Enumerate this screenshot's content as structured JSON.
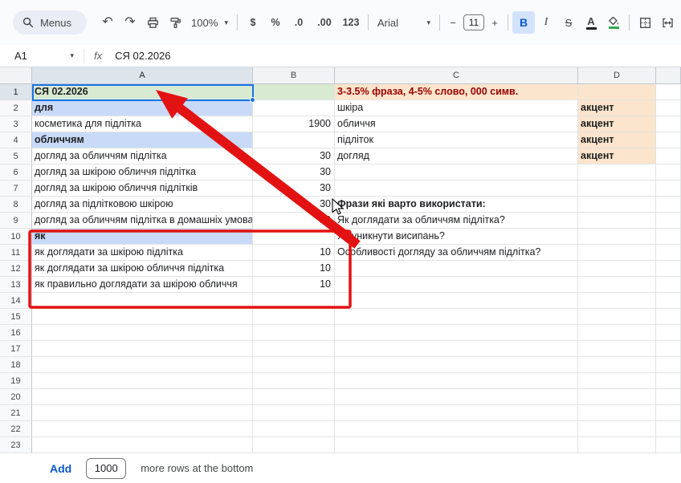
{
  "toolbar": {
    "menus_label": "Menus",
    "zoom": "100%",
    "currency": "$",
    "percent": "%",
    "decrease_decimal": ".0",
    "increase_decimal": ".00",
    "number_format": "123",
    "font_family": "Arial",
    "font_size": "11",
    "decrease_font": "−",
    "increase_font": "+",
    "bold": "B",
    "italic": "I",
    "strikethrough": "S",
    "text_color": "A"
  },
  "icons": {
    "dropdown": "▾",
    "undo": "↶",
    "redo": "↷"
  },
  "formula_bar": {
    "cell_reference": "A1",
    "fx_label": "fx",
    "formula_value": "СЯ 02.2026"
  },
  "sheet": {
    "columns": [
      "A",
      "B",
      "C",
      "D"
    ],
    "row_count": 23,
    "selected_cell": "A1",
    "selected_col": "A",
    "selected_row": 1,
    "cells": [
      {
        "c": "A",
        "r": 1,
        "t": "СЯ 02.2026",
        "s": [
          "green",
          "bold"
        ]
      },
      {
        "c": "B",
        "r": 1,
        "t": "",
        "s": [
          "green"
        ]
      },
      {
        "c": "C",
        "r": 1,
        "t": "3-3.5% фраза, 4-5% слово, 000 симв.",
        "s": [
          "peach",
          "bold",
          "darkred"
        ]
      },
      {
        "c": "D",
        "r": 1,
        "t": "",
        "s": [
          "peach"
        ]
      },
      {
        "c": "A",
        "r": 2,
        "t": "для",
        "s": [
          "lav",
          "bold"
        ]
      },
      {
        "c": "C",
        "r": 2,
        "t": "шкіра",
        "s": []
      },
      {
        "c": "D",
        "r": 2,
        "t": "акцент",
        "s": [
          "peach",
          "bold"
        ]
      },
      {
        "c": "A",
        "r": 3,
        "t": "косметика для підлітка",
        "s": []
      },
      {
        "c": "B",
        "r": 3,
        "t": "1900",
        "s": [
          "num"
        ]
      },
      {
        "c": "C",
        "r": 3,
        "t": "обличчя",
        "s": []
      },
      {
        "c": "D",
        "r": 3,
        "t": "акцент",
        "s": [
          "peach",
          "bold"
        ]
      },
      {
        "c": "A",
        "r": 4,
        "t": "обличчям",
        "s": [
          "lav",
          "bold"
        ]
      },
      {
        "c": "C",
        "r": 4,
        "t": "підліток",
        "s": []
      },
      {
        "c": "D",
        "r": 4,
        "t": "акцент",
        "s": [
          "peach",
          "bold"
        ]
      },
      {
        "c": "A",
        "r": 5,
        "t": "догляд за обличчям підлітка",
        "s": []
      },
      {
        "c": "B",
        "r": 5,
        "t": "30",
        "s": [
          "num"
        ]
      },
      {
        "c": "C",
        "r": 5,
        "t": "догляд",
        "s": []
      },
      {
        "c": "D",
        "r": 5,
        "t": "акцент",
        "s": [
          "peach",
          "bold"
        ]
      },
      {
        "c": "A",
        "r": 6,
        "t": "догляд за шкірою обличчя підлітка",
        "s": []
      },
      {
        "c": "B",
        "r": 6,
        "t": "30",
        "s": [
          "num"
        ]
      },
      {
        "c": "A",
        "r": 7,
        "t": "догляд за шкірою обличчя підлітків",
        "s": []
      },
      {
        "c": "B",
        "r": 7,
        "t": "30",
        "s": [
          "num"
        ]
      },
      {
        "c": "A",
        "r": 8,
        "t": "догляд за підлітковою шкірою",
        "s": []
      },
      {
        "c": "B",
        "r": 8,
        "t": "30",
        "s": [
          "num"
        ]
      },
      {
        "c": "C",
        "r": 8,
        "t": "Фрази які варто використати:",
        "s": [
          "bold"
        ]
      },
      {
        "c": "A",
        "r": 9,
        "t": "догляд за обличчям підлітка в домашніх умовах",
        "s": []
      },
      {
        "c": "B",
        "r": 9,
        "t": "10",
        "s": [
          "num"
        ]
      },
      {
        "c": "C",
        "r": 9,
        "t": "Як доглядати за обличчям підлітка?",
        "s": []
      },
      {
        "c": "A",
        "r": 10,
        "t": "як",
        "s": [
          "lav",
          "bold"
        ]
      },
      {
        "c": "C",
        "r": 10,
        "t": "Як уникнути висипань?",
        "s": []
      },
      {
        "c": "A",
        "r": 11,
        "t": "як доглядати за шкірою підлітка",
        "s": []
      },
      {
        "c": "B",
        "r": 11,
        "t": "10",
        "s": [
          "num"
        ]
      },
      {
        "c": "C",
        "r": 11,
        "t": "Особливості догляду за обличчям підлітка?",
        "s": []
      },
      {
        "c": "A",
        "r": 12,
        "t": "як доглядати за шкірою обличчя підлітка",
        "s": []
      },
      {
        "c": "B",
        "r": 12,
        "t": "10",
        "s": [
          "num"
        ]
      },
      {
        "c": "A",
        "r": 13,
        "t": "як правильно доглядати за шкірою обличчя",
        "s": []
      },
      {
        "c": "B",
        "r": 13,
        "t": "10",
        "s": [
          "num"
        ]
      }
    ]
  },
  "bottom_bar": {
    "add_label": "Add",
    "rows_count": "1000",
    "suffix": "more rows at the bottom"
  },
  "colors": {
    "green_fill": "#d9ead3",
    "peach_fill": "#fce5cd",
    "lavender_fill": "#c9daf8",
    "darkred_text": "#990000",
    "selection_blue": "#1a73e8",
    "annotation_red": "#e31212",
    "active_button_bg": "#d3e3fd",
    "accent_blue": "#0b57d0"
  }
}
